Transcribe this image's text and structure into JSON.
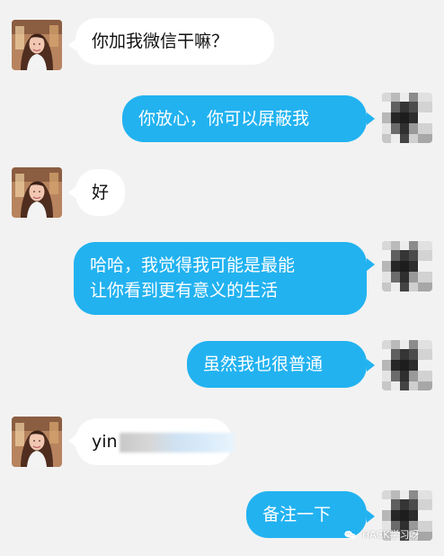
{
  "messages": [
    {
      "side": "left",
      "text": "你加我微信干嘛？"
    },
    {
      "side": "right",
      "text": "你放心，你可以屏蔽我"
    },
    {
      "side": "left",
      "text": "好"
    },
    {
      "side": "right",
      "lines": [
        "哈哈，我觉得我可能是最能",
        "让你看到更有意义的生活"
      ]
    },
    {
      "side": "right",
      "text": "虽然我也很普通"
    },
    {
      "side": "left",
      "text_prefix": "yin"
    },
    {
      "side": "right",
      "text": "备注一下"
    }
  ],
  "watermark": {
    "text": "HACK学习呀"
  },
  "colors": {
    "background": "#f2f2f2",
    "incoming_bubble": "#ffffff",
    "outgoing_bubble": "#22b2f0",
    "outgoing_text": "#ffffff",
    "incoming_text": "#111111"
  }
}
